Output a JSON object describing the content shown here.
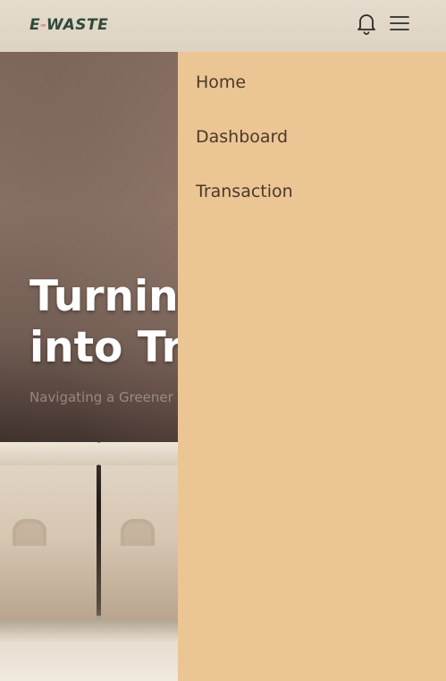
{
  "header": {
    "logo_prefix": "E",
    "logo_dash": "-",
    "logo_suffix": "WASTE",
    "notification_icon": "bell-icon",
    "menu_icon": "hamburger-menu-icon"
  },
  "hero": {
    "title_line1": "Turning",
    "title_line2": "into Treasure",
    "subtitle": "Navigating a Greener Future"
  },
  "side_menu": {
    "items": [
      {
        "label": "Home"
      },
      {
        "label": "Dashboard"
      },
      {
        "label": "Transaction"
      }
    ]
  },
  "colors": {
    "menu_background": "#ebc594",
    "logo_text": "#2f4a3a",
    "logo_accent": "#e88a93",
    "menu_text": "#4a3a28"
  }
}
